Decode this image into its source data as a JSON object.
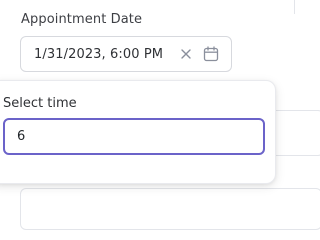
{
  "field": {
    "label": "Appointment Date",
    "value": "1/31/2023, 6:00 PM",
    "clear_icon": "close-icon",
    "calendar_icon": "calendar-icon"
  },
  "time_picker": {
    "label": "Select time",
    "value": "6"
  },
  "colors": {
    "focus_border": "#6b63c9",
    "field_border": "#d7d9de",
    "icon": "#8a8f9c"
  }
}
